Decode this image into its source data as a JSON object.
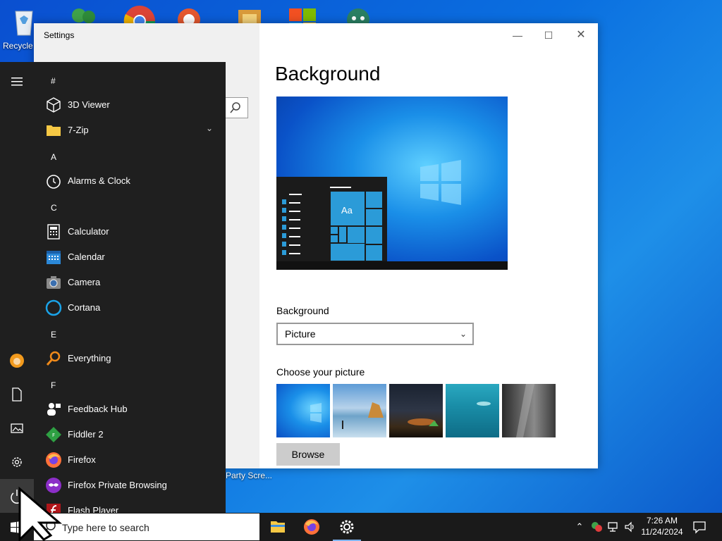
{
  "desktop": {
    "recycle_label": "Recycle",
    "partial_label": "Party Scre..."
  },
  "settings": {
    "title": "Settings",
    "page_title": "Background",
    "background_label": "Background",
    "background_value": "Picture",
    "choose_label": "Choose your picture",
    "browse_label": "Browse",
    "preview_sample_text": "Aa",
    "controls": {
      "minimize": "—",
      "maximize": "☐",
      "close": "✕"
    }
  },
  "start_menu": {
    "groups": [
      {
        "letter": "#",
        "items": [
          {
            "label": "3D Viewer",
            "icon": "cube-icon"
          },
          {
            "label": "7-Zip",
            "icon": "folder-icon",
            "expandable": true
          }
        ]
      },
      {
        "letter": "A",
        "items": [
          {
            "label": "Alarms & Clock",
            "icon": "alarm-clock-icon"
          }
        ]
      },
      {
        "letter": "C",
        "items": [
          {
            "label": "Calculator",
            "icon": "calculator-icon"
          },
          {
            "label": "Calendar",
            "icon": "calendar-icon"
          },
          {
            "label": "Camera",
            "icon": "camera-icon"
          },
          {
            "label": "Cortana",
            "icon": "cortana-icon"
          }
        ]
      },
      {
        "letter": "E",
        "items": [
          {
            "label": "Everything",
            "icon": "magnifier-icon"
          }
        ]
      },
      {
        "letter": "F",
        "items": [
          {
            "label": "Feedback Hub",
            "icon": "feedback-icon"
          },
          {
            "label": "Fiddler 2",
            "icon": "fiddler-icon"
          },
          {
            "label": "Firefox",
            "icon": "firefox-icon"
          },
          {
            "label": "Firefox Private Browsing",
            "icon": "firefox-private-icon"
          },
          {
            "label": "Flash Player",
            "icon": "flash-icon"
          }
        ]
      }
    ]
  },
  "taskbar": {
    "search_placeholder": "Type here to search",
    "time": "7:26 AM",
    "date": "11/24/2024"
  }
}
